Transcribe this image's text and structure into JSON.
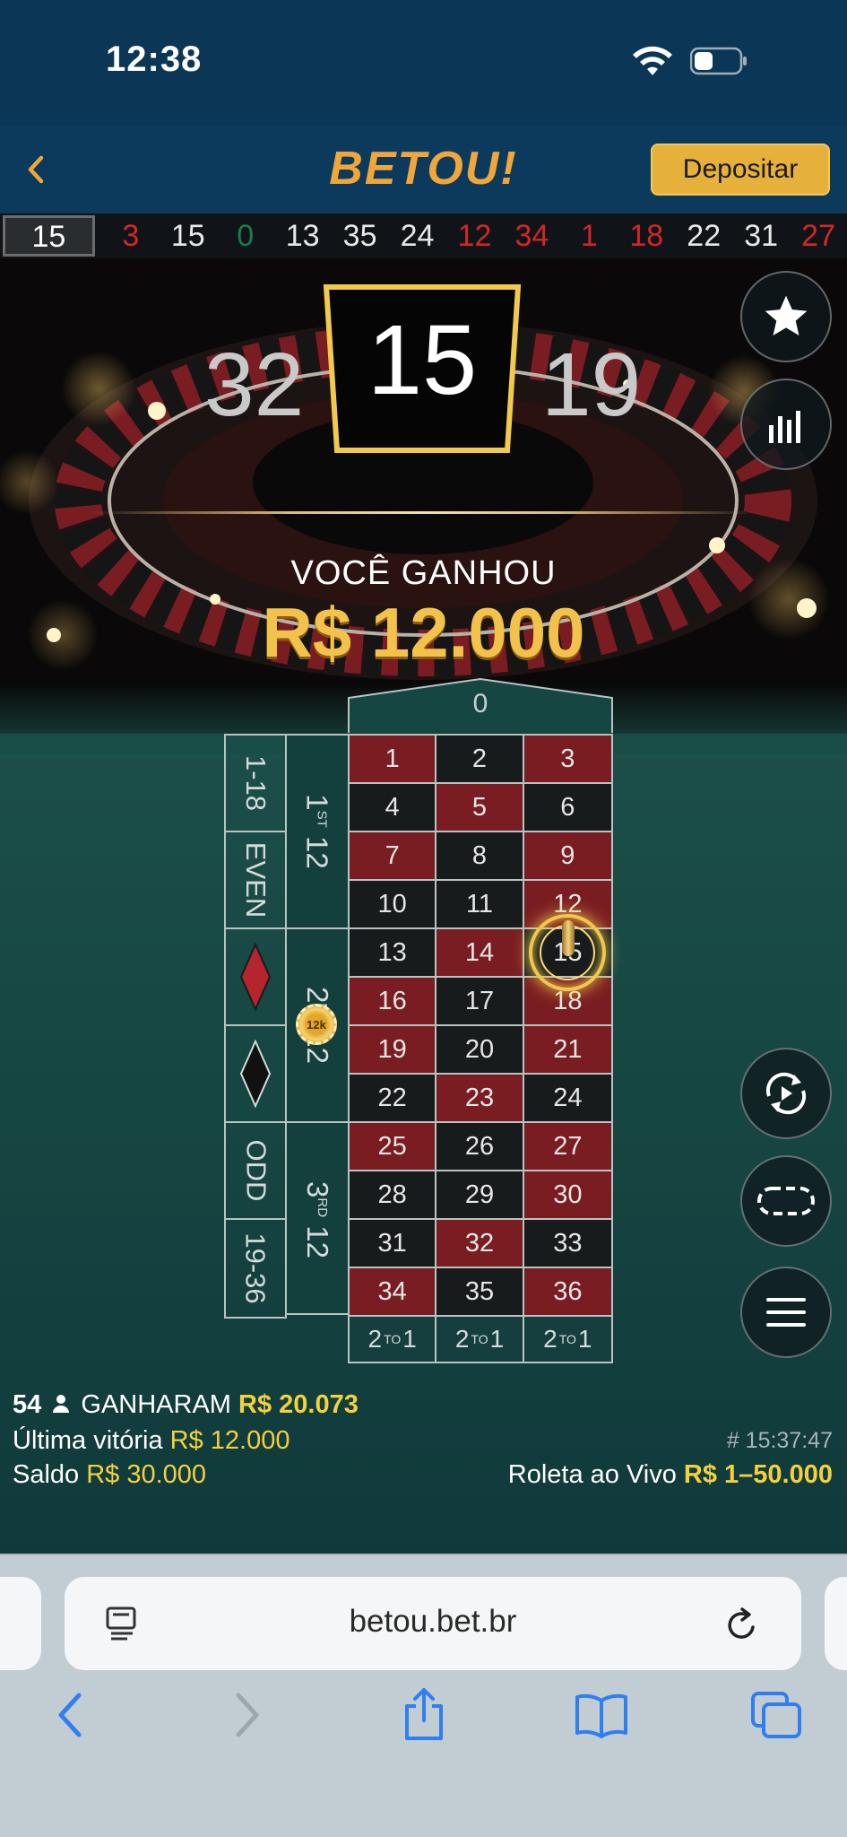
{
  "status_bar": {
    "time": "12:38"
  },
  "header": {
    "brand": "BETOU!",
    "deposit_label": "Depositar"
  },
  "history": {
    "current": "15",
    "items": [
      {
        "value": "3",
        "color": "red"
      },
      {
        "value": "15",
        "color": "black"
      },
      {
        "value": "0",
        "color": "green"
      },
      {
        "value": "13",
        "color": "black"
      },
      {
        "value": "35",
        "color": "black"
      },
      {
        "value": "24",
        "color": "black"
      },
      {
        "value": "12",
        "color": "red"
      },
      {
        "value": "34",
        "color": "red"
      },
      {
        "value": "1",
        "color": "red"
      },
      {
        "value": "18",
        "color": "red"
      },
      {
        "value": "22",
        "color": "black"
      },
      {
        "value": "31",
        "color": "black"
      },
      {
        "value": "27",
        "color": "red"
      }
    ]
  },
  "result": {
    "number": "15",
    "left_neighbor": "32",
    "right_neighbor": "19",
    "win_label": "VOCÊ GANHOU",
    "win_amount": "R$ 12.000"
  },
  "table": {
    "zero": "0",
    "outside_bets": [
      "1-18",
      "EVEN",
      "red-diamond",
      "black-diamond",
      "ODD",
      "19-36"
    ],
    "dozens": [
      {
        "num": "1",
        "sup": "ST",
        "suffix": "12"
      },
      {
        "num": "2",
        "sup": "ND",
        "suffix": "12"
      },
      {
        "num": "3",
        "sup": "RD",
        "suffix": "12"
      }
    ],
    "numbers": [
      {
        "n": "1",
        "c": "red"
      },
      {
        "n": "2",
        "c": "black"
      },
      {
        "n": "3",
        "c": "red"
      },
      {
        "n": "4",
        "c": "black"
      },
      {
        "n": "5",
        "c": "red"
      },
      {
        "n": "6",
        "c": "black"
      },
      {
        "n": "7",
        "c": "red"
      },
      {
        "n": "8",
        "c": "black"
      },
      {
        "n": "9",
        "c": "red"
      },
      {
        "n": "10",
        "c": "black"
      },
      {
        "n": "11",
        "c": "black"
      },
      {
        "n": "12",
        "c": "red"
      },
      {
        "n": "13",
        "c": "black"
      },
      {
        "n": "14",
        "c": "red"
      },
      {
        "n": "15",
        "c": "black"
      },
      {
        "n": "16",
        "c": "red"
      },
      {
        "n": "17",
        "c": "black"
      },
      {
        "n": "18",
        "c": "red"
      },
      {
        "n": "19",
        "c": "red"
      },
      {
        "n": "20",
        "c": "black"
      },
      {
        "n": "21",
        "c": "red"
      },
      {
        "n": "22",
        "c": "black"
      },
      {
        "n": "23",
        "c": "red"
      },
      {
        "n": "24",
        "c": "black"
      },
      {
        "n": "25",
        "c": "red"
      },
      {
        "n": "26",
        "c": "black"
      },
      {
        "n": "27",
        "c": "red"
      },
      {
        "n": "28",
        "c": "black"
      },
      {
        "n": "29",
        "c": "black"
      },
      {
        "n": "30",
        "c": "red"
      },
      {
        "n": "31",
        "c": "black"
      },
      {
        "n": "32",
        "c": "red"
      },
      {
        "n": "33",
        "c": "black"
      },
      {
        "n": "34",
        "c": "red"
      },
      {
        "n": "35",
        "c": "black"
      },
      {
        "n": "36",
        "c": "red"
      }
    ],
    "column_bet": {
      "pre": "2",
      "sup": "TO",
      "post": "1"
    },
    "chip_label": "12k"
  },
  "info": {
    "players_count": "54",
    "players_label": "GANHARAM",
    "players_amount": "R$ 20.073",
    "last_win_label": "Última vitória",
    "last_win_amount": "R$ 12.000",
    "balance_label": "Saldo",
    "balance_amount": "R$ 30.000",
    "round_id": "# 15:37:47",
    "game_name": "Roleta ao Vivo",
    "limits": "R$ 1–50.000"
  },
  "browser": {
    "url": "betou.bet.br"
  },
  "colors": {
    "red": "#7a1d22",
    "black": "#171b1c",
    "gold": "#f2d13c",
    "brand": "#f0a63a",
    "deposit": "#e6b13b",
    "felt": "#164642"
  }
}
